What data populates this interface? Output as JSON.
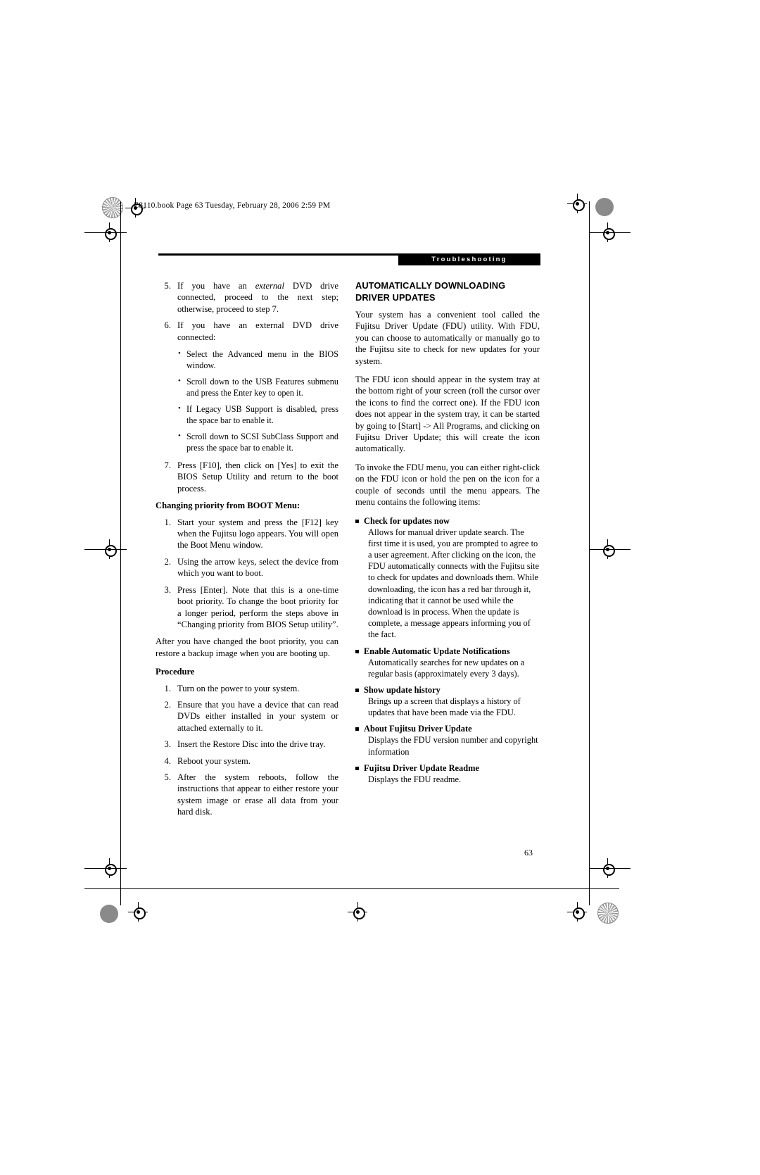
{
  "header": {
    "book_line": "E8110.book  Page 63  Tuesday, February 28, 2006  2:59 PM",
    "tab_label": "Troubleshooting",
    "page_number": "63"
  },
  "left_column": {
    "steps_continued": [
      {
        "n": "5.",
        "text": "If you have an external DVD drive connected, proceed to the next step; otherwise, proceed to step 7.",
        "italic_word": "external"
      },
      {
        "n": "6.",
        "text": "If you have an external DVD drive connected:"
      }
    ],
    "sub_bullets": [
      "Select the Advanced menu in the BIOS window.",
      "Scroll down to the USB Features submenu and press the Enter key to open it.",
      "If Legacy USB Support is disabled, press the space bar to enable it.",
      "Scroll down to SCSI SubClass Support and press the space bar to enable it."
    ],
    "step7": {
      "n": "7.",
      "text": "Press [F10], then click on [Yes] to exit the BIOS Setup Utility and return to the boot process."
    },
    "boot_menu_heading": "Changing priority from BOOT Menu:",
    "boot_menu_steps": [
      {
        "n": "1.",
        "text": "Start your system and press the [F12] key when the Fujitsu logo appears. You will open the Boot Menu window."
      },
      {
        "n": "2.",
        "text": "Using the arrow keys, select the device from which you want to boot."
      },
      {
        "n": "3.",
        "text": "Press [Enter]. Note that this is a one-time boot priority. To change the boot priority for a longer period, perform the steps above in “Changing priority from BIOS Setup utility”."
      }
    ],
    "after_paragraph": "After you have changed the boot priority, you can restore a backup image when you are booting up.",
    "procedure_heading": "Procedure",
    "procedure_steps": [
      {
        "n": "1.",
        "text": "Turn on the power to your system."
      },
      {
        "n": "2.",
        "text": "Ensure that you have a device that can read DVDs either installed in your system or attached externally to it."
      },
      {
        "n": "3.",
        "text": "Insert the Restore Disc into the drive tray."
      },
      {
        "n": "4.",
        "text": "Reboot your system."
      },
      {
        "n": "5.",
        "text": "After the system reboots, follow the instructions that appear to either restore your system image or erase all data from your hard disk."
      }
    ]
  },
  "right_column": {
    "heading_line1": "AUTOMATICALLY DOWNLOADING",
    "heading_line2": "DRIVER UPDATES",
    "paragraphs": [
      "Your system has a convenient tool called the Fujitsu Driver Update (FDU) utility. With FDU, you can choose to automatically or manually go to the Fujitsu site to check for new updates for your system.",
      "The FDU icon should appear in the system tray at the bottom right of your screen (roll the cursor over the icons to find the correct one). If the FDU icon does not appear in the system tray, it can be started by going to [Start] -> All Programs, and clicking on Fujitsu Driver Update; this will create the icon automatically.",
      "To invoke the FDU menu, you can either right-click on the FDU icon or hold the pen on the icon for a couple of seconds until the menu appears. The menu contains the following items:"
    ],
    "menu_items": [
      {
        "title": "Check for updates now",
        "description": "Allows for manual driver update search. The first time it is used, you are prompted to agree to a user agreement. After clicking on the icon, the FDU automatically connects with the Fujitsu site to check for updates and downloads them. While downloading, the icon has a red bar through it, indicating that it cannot be used while the download is in process. When the update is complete, a message appears informing you of the fact."
      },
      {
        "title": "Enable Automatic Update Notifications",
        "description": "Automatically searches for new updates on a regular basis (approximately every 3 days)."
      },
      {
        "title": "Show update history",
        "description": "Brings up a screen that displays a history of updates that have been made via the FDU."
      },
      {
        "title": "About Fujitsu Driver Update",
        "description": "Displays the FDU version number and copyright information"
      },
      {
        "title": "Fujitsu Driver Update Readme",
        "description": "Displays the FDU readme."
      }
    ]
  }
}
